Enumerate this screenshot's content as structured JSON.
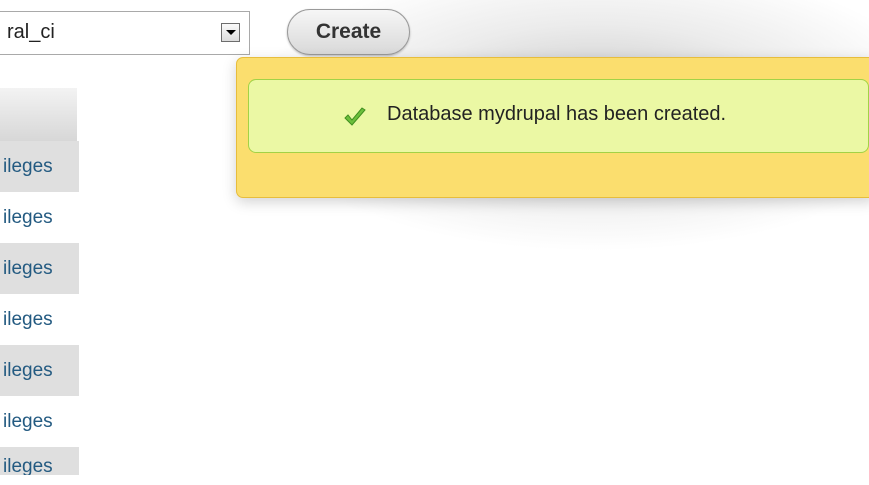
{
  "form": {
    "collation_value": "ral_ci",
    "create_label": "Create"
  },
  "notice": {
    "message": "Database mydrupal has been created.",
    "icon": "check-icon"
  },
  "privileges": [
    {
      "label": "ileges"
    },
    {
      "label": "ileges"
    },
    {
      "label": "ileges"
    },
    {
      "label": "ileges"
    },
    {
      "label": "ileges"
    },
    {
      "label": "ileges"
    },
    {
      "label": "ileges"
    }
  ],
  "colors": {
    "notice_outer": "#fbde6e",
    "notice_inner": "#ebf8a4",
    "link": "#235a81"
  }
}
